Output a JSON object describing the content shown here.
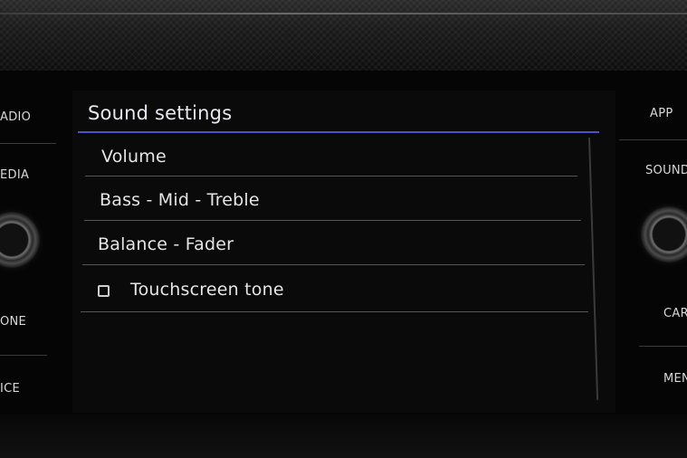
{
  "header": {
    "title": "Sound settings"
  },
  "menu": {
    "items": [
      {
        "label": "Volume"
      },
      {
        "label": "Bass - Mid - Treble"
      },
      {
        "label": "Balance - Fader"
      },
      {
        "label": "Touchscreen tone",
        "checked": false
      }
    ]
  },
  "left_keys": [
    "ADIO",
    "EDIA",
    "ONE",
    "ICE"
  ],
  "right_keys": [
    "APP",
    "SOUND",
    "CAR",
    "MEN"
  ],
  "colors": {
    "accent": "#4a52c9"
  }
}
